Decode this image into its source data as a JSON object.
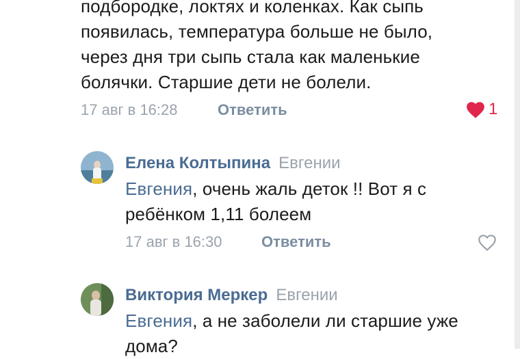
{
  "comment0": {
    "lines": [
      "подбородке, локтях и коленках.  Как сыпь",
      "появилась, температура больше не было,",
      "через дня три сыпь стала как маленькие",
      "болячки. Старшие дети не болели."
    ],
    "time": "17 авг в 16:28",
    "reply": "Ответить",
    "likes": "1"
  },
  "comment1": {
    "author": "Елена Колтыпина",
    "to": "Евгении",
    "mention": "Евгения",
    "line1_rest": ", очень жаль деток !! Вот я с",
    "line2": "ребёнком 1,11 болеем",
    "time": "17 авг в 16:30",
    "reply": "Ответить"
  },
  "comment2": {
    "author": "Виктория Меркер",
    "to": "Евгении",
    "mention": "Евгения",
    "line1_rest": ", а не заболели ли старшие уже",
    "line2": "дома?"
  },
  "colors": {
    "link": "#4a6c93",
    "meta": "#9aa3ad",
    "heart_active": "#e0264b",
    "heart_outline": "#9aa3ad"
  },
  "icons": [
    "heart-filled-icon",
    "heart-outline-icon",
    "avatar"
  ]
}
